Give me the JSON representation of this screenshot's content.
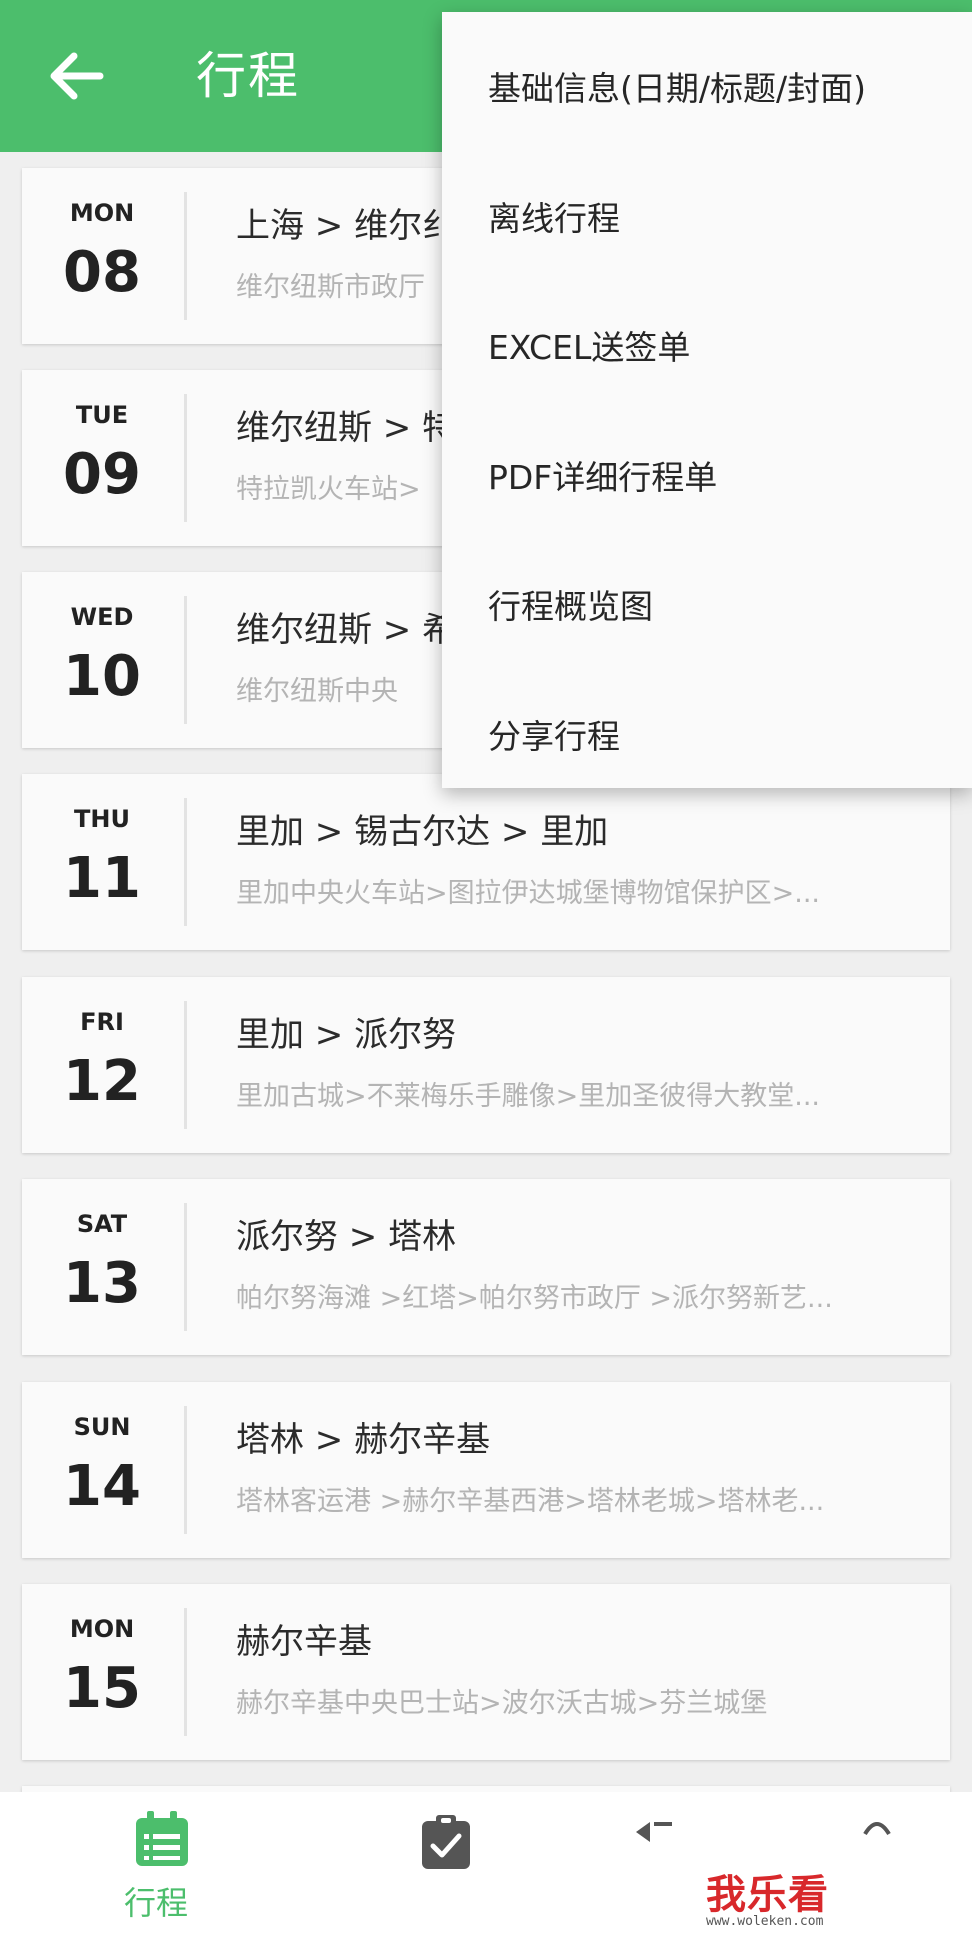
{
  "header": {
    "title": "行程",
    "back_icon": "arrow-left-icon"
  },
  "itinerary": [
    {
      "dow": "MON",
      "day": "08",
      "route": "上海 > 维尔纟",
      "stops": "维尔纽斯市政厅"
    },
    {
      "dow": "TUE",
      "day": "09",
      "route": "维尔纽斯 > 特",
      "stops": "特拉凯火车站>"
    },
    {
      "dow": "WED",
      "day": "10",
      "route": "维尔纽斯 > 希",
      "stops": "维尔纽斯中央"
    },
    {
      "dow": "THU",
      "day": "11",
      "route": "里加 > 锡古尔达 > 里加",
      "stops": "里加中央火车站>图拉伊达城堡博物馆保护区>..."
    },
    {
      "dow": "FRI",
      "day": "12",
      "route": "里加 > 派尔努",
      "stops": "里加古城>不莱梅乐手雕像>里加圣彼得大教堂..."
    },
    {
      "dow": "SAT",
      "day": "13",
      "route": "派尔努 > 塔林",
      "stops": "帕尔努海滩 >红塔>帕尔努市政厅 >派尔努新艺..."
    },
    {
      "dow": "SUN",
      "day": "14",
      "route": "塔林 > 赫尔辛基",
      "stops": "塔林客运港 >赫尔辛基西港>塔林老城>塔林老..."
    },
    {
      "dow": "MON",
      "day": "15",
      "route": "赫尔辛基",
      "stops": "赫尔辛基中央巴士站>波尔沃古城>芬兰城堡"
    }
  ],
  "menu": [
    "基础信息(日期/标题/封面)",
    "离线行程",
    "EXCEL送签单",
    "PDF详细行程单",
    "行程概览图",
    "分享行程"
  ],
  "bottom_nav": {
    "itinerary_label": "行程",
    "itinerary_icon": "calendar-list-icon",
    "checklist_icon": "clipboard-check-icon"
  },
  "watermark": {
    "text": "我乐看",
    "url": "www.woleken.com"
  },
  "colors": {
    "accent": "#4cbe6c",
    "watermark": "#d8282b"
  }
}
